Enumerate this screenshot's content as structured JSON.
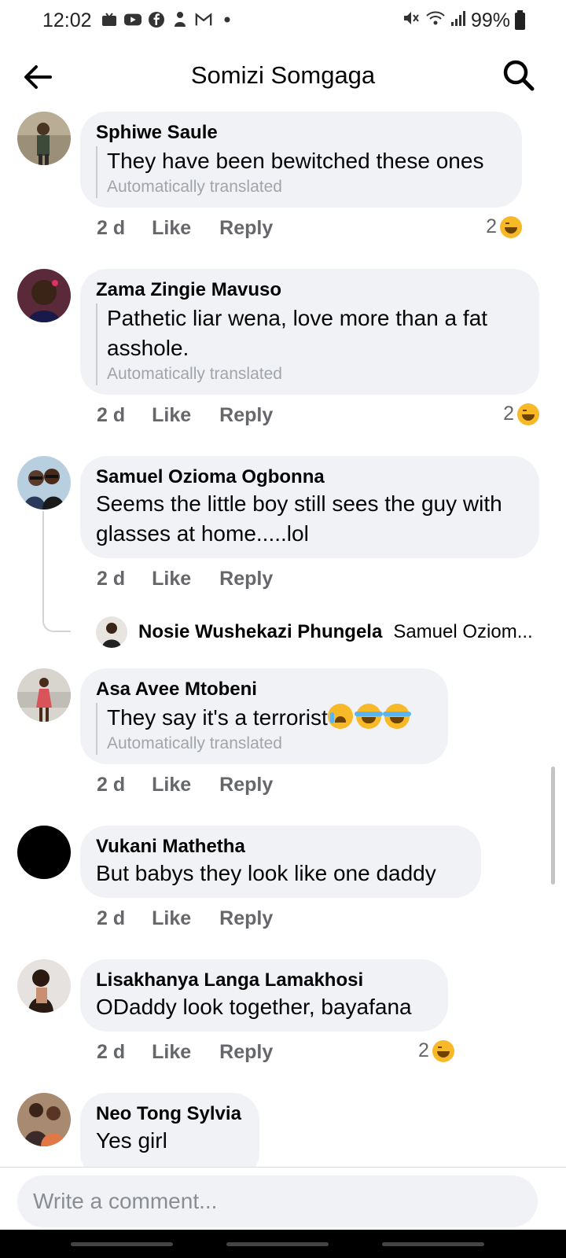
{
  "status_bar": {
    "time": "12:02",
    "battery": "99%",
    "icons": [
      "inbox-icon",
      "youtube-icon",
      "facebook-icon",
      "hand-icon",
      "gmail-icon",
      "dot-icon",
      "mute-icon",
      "wifi-icon",
      "signal-icon",
      "battery-icon"
    ]
  },
  "header": {
    "title": "Somizi Somgaga"
  },
  "comments": [
    {
      "author": "Sphiwe Saule",
      "text": "They have been bewitched these ones",
      "translated_note": "Automatically translated",
      "time": "2 d",
      "like": "Like",
      "reply": "Reply",
      "reactions": "2"
    },
    {
      "author": "Zama Zingie Mavuso",
      "text": "Pathetic liar wena, love more than a fat asshole.",
      "translated_note": "Automatically translated",
      "time": "2 d",
      "like": "Like",
      "reply": "Reply",
      "reactions": "2"
    },
    {
      "author": "Samuel Ozioma Ogbonna",
      "text": "Seems the little boy still sees the guy with glasses at home.....lol",
      "time": "2 d",
      "like": "Like",
      "reply": "Reply",
      "reply_author": "Nosie Wushekazi Phungela",
      "reply_preview": "Samuel Oziom..."
    },
    {
      "author": "Asa Avee Mtobeni",
      "text": "They say it's a terrorist",
      "translated_note": "Automatically translated",
      "time": "2 d",
      "like": "Like",
      "reply": "Reply"
    },
    {
      "author": "Vukani Mathetha",
      "text": "But  babys they look like one daddy",
      "time": "2 d",
      "like": "Like",
      "reply": "Reply"
    },
    {
      "author": "Lisakhanya Langa Lamakhosi",
      "text": "ODaddy look together, bayafana",
      "time": "2 d",
      "like": "Like",
      "reply": "Reply",
      "reactions": "2"
    },
    {
      "author": "Neo Tong Sylvia",
      "text": "Yes girl"
    }
  ],
  "composer": {
    "placeholder": "Write a comment..."
  },
  "colors": {
    "bubble": "#f0f2f5",
    "secondary_text": "#65676b",
    "haha_reaction": "#f7b928"
  }
}
